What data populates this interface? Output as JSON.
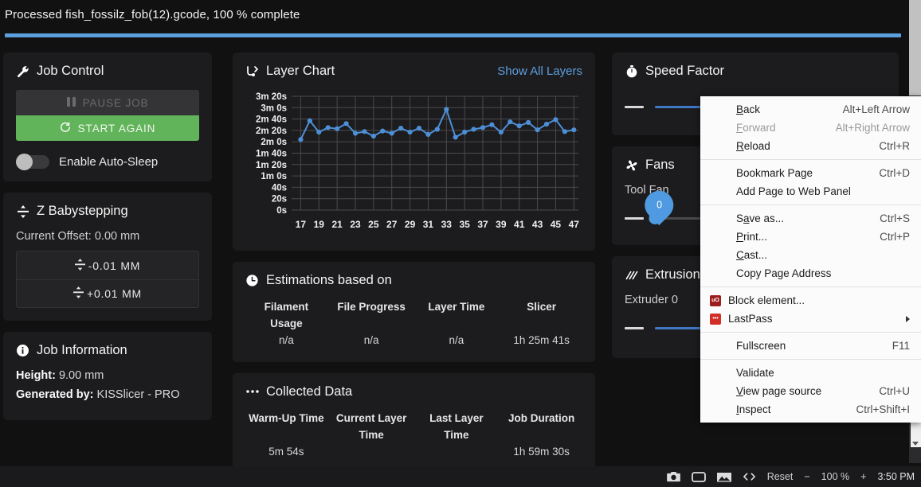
{
  "topbar": {
    "message": "Processed fish_fossilz_fob(12).gcode, 100 % complete",
    "progress_percent": 100
  },
  "job_control": {
    "title": "Job Control",
    "title_icon": "wrench-icon",
    "pause_label": "PAUSE JOB",
    "start_label": "START AGAIN",
    "toggle_label": "Enable Auto-Sleep",
    "toggle_on": false
  },
  "z_babystepping": {
    "title": "Z Babystepping",
    "title_icon": "arrows-v-icon",
    "current_offset": "Current Offset: 0.00 mm",
    "minus_label": "-0.01 MM",
    "plus_label": "+0.01 MM"
  },
  "job_information": {
    "title": "Job Information",
    "title_icon": "info-circle-icon",
    "height_key": "Height:",
    "height_value": "9.00 mm",
    "generated_key": "Generated by:",
    "generated_value": "KISSlicer - PRO"
  },
  "layer_chart": {
    "title": "Layer Chart",
    "title_icon": "chart-branch-icon",
    "link_label": "Show All Layers"
  },
  "chart_data": {
    "type": "line",
    "title": "Layer Chart",
    "xlabel": "",
    "ylabel": "",
    "xlim": [
      16,
      47.5
    ],
    "ylim": [
      0,
      200
    ],
    "ytick_values": [
      0,
      20,
      40,
      60,
      80,
      100,
      120,
      140,
      160,
      180,
      200
    ],
    "ytick_labels": [
      "0s",
      "20s",
      "40s",
      "1m 0s",
      "1m 20s",
      "1m 40s",
      "2m 0s",
      "2m 20s",
      "2m 40s",
      "3m 0s",
      "3m 20s"
    ],
    "xtick_values": [
      17,
      19,
      21,
      23,
      25,
      27,
      29,
      31,
      33,
      35,
      37,
      39,
      41,
      43,
      45,
      47
    ],
    "xtick_labels": [
      "17",
      "19",
      "21",
      "23",
      "25",
      "27",
      "29",
      "31",
      "33",
      "35",
      "37",
      "39",
      "41",
      "43",
      "45",
      "47"
    ],
    "grid": true,
    "series_color": "#4d8fd6",
    "series": [
      {
        "name": "Layer Time",
        "x": [
          17,
          18,
          19,
          20,
          21,
          22,
          23,
          24,
          25,
          26,
          27,
          28,
          29,
          30,
          31,
          32,
          33,
          34,
          35,
          36,
          37,
          38,
          39,
          40,
          41,
          42,
          43,
          44,
          45,
          46,
          47
        ],
        "values": [
          124,
          157,
          137,
          145,
          143,
          152,
          135,
          138,
          130,
          139,
          135,
          144,
          137,
          144,
          133,
          142,
          177,
          128,
          137,
          142,
          145,
          150,
          137,
          155,
          148,
          154,
          141,
          151,
          159,
          138,
          141
        ]
      }
    ]
  },
  "estimations": {
    "title": "Estimations based on",
    "title_icon": "clock-icon",
    "headers": [
      "Filament Usage",
      "File Progress",
      "Layer Time",
      "Slicer"
    ],
    "values": [
      "n/a",
      "n/a",
      "n/a",
      "1h 25m 41s"
    ]
  },
  "collected_data": {
    "title": "Collected Data",
    "title_icon": "dots-icon",
    "headers": [
      "Warm-Up Time",
      "Current Layer Time",
      "Last Layer Time",
      "Job Duration"
    ],
    "values": [
      "5m 54s",
      "",
      "",
      "1h 59m 30s"
    ]
  },
  "speed_factor": {
    "title": "Speed Factor",
    "title_icon": "stopwatch-icon",
    "value_label": "—"
  },
  "fans": {
    "title": "Fans",
    "title_icon": "fan-icon",
    "channel_label": "Tool Fan",
    "value_label": "—",
    "bubble_value": "0",
    "slider_percent": 0
  },
  "extrusion": {
    "title": "Extrusion F",
    "title_icon": "hatch-icon",
    "channel_label": "Extruder 0",
    "value_label": "—",
    "slider_percent": 66
  },
  "context_menu": {
    "groups": [
      [
        {
          "label": "Back",
          "accel": "Alt+Left Arrow",
          "mnemonic": "B",
          "disabled": false
        },
        {
          "label": "Forward",
          "accel": "Alt+Right Arrow",
          "mnemonic": "F",
          "disabled": true
        },
        {
          "label": "Reload",
          "accel": "Ctrl+R",
          "mnemonic": "R",
          "disabled": false
        }
      ],
      [
        {
          "label": "Bookmark Page",
          "accel": "Ctrl+D",
          "disabled": false
        },
        {
          "label": "Add Page to Web Panel",
          "accel": "",
          "disabled": false
        }
      ],
      [
        {
          "label": "Save as...",
          "accel": "Ctrl+S",
          "mnemonic": "a",
          "disabled": false
        },
        {
          "label": "Print...",
          "accel": "Ctrl+P",
          "mnemonic": "P",
          "disabled": false
        },
        {
          "label": "Cast...",
          "accel": "",
          "mnemonic": "C",
          "disabled": false
        },
        {
          "label": "Copy Page Address",
          "accel": "",
          "disabled": false
        }
      ],
      [
        {
          "label": "Block element...",
          "accel": "",
          "icon": "ublock-shield-icon",
          "icon_color": "#9c1d1d",
          "icon_text": "uO",
          "disabled": false
        },
        {
          "label": "LastPass",
          "accel": "",
          "icon": "lastpass-icon",
          "icon_color": "#d32d27",
          "icon_text": "•••",
          "submenu": true,
          "disabled": false
        }
      ],
      [
        {
          "label": "Fullscreen",
          "accel": "F11",
          "disabled": false
        }
      ],
      [
        {
          "label": "Validate",
          "accel": "",
          "disabled": false
        },
        {
          "label": "View page source",
          "accel": "Ctrl+U",
          "mnemonic": "V",
          "disabled": false
        },
        {
          "label": "Inspect",
          "accel": "Ctrl+Shift+I",
          "mnemonic": "I",
          "disabled": false
        }
      ]
    ]
  },
  "statusbar": {
    "icons": [
      "camera-icon",
      "screenshot-rect-icon",
      "image-icon",
      "code-brackets-icon"
    ],
    "reset_label": "Reset",
    "zoom_out_label": "−",
    "zoom_label": "100 %",
    "zoom_in_label": "+",
    "clock": "3:50 PM"
  }
}
